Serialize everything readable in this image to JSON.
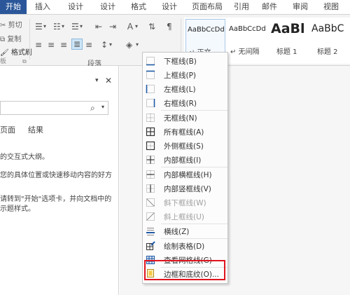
{
  "tabs": [
    "开始",
    "插入",
    "设计",
    "设计",
    "格式",
    "设计",
    "页面布局",
    "引用",
    "邮件",
    "审阅",
    "视图"
  ],
  "clipboard": {
    "cut": "剪切",
    "copy": "复制",
    "format_painter": "格式刷"
  },
  "paragraph_group_label": "段落",
  "styles": [
    {
      "sample": "AaBbCcDd",
      "name": "↵ 正文"
    },
    {
      "sample": "AaBbCcDd",
      "name": "↵ 无间隔"
    },
    {
      "sample": "AaBl",
      "name": "标题 1"
    },
    {
      "sample": "AaBbC",
      "name": "标题 2"
    }
  ],
  "nav": {
    "tabs": [
      "页面",
      "结果"
    ],
    "lines": [
      "的交互式大纲。",
      "您的具体位置或快速移动内容的好方",
      "请转到\"开始\"选项卡，并向文档中的",
      "示题样式。"
    ]
  },
  "menu": {
    "items": [
      {
        "label": "下框线(B)",
        "icon": "bottom-border-icon",
        "disabled": false
      },
      {
        "label": "上框线(P)",
        "icon": "top-border-icon",
        "disabled": false
      },
      {
        "label": "左框线(L)",
        "icon": "left-border-icon",
        "disabled": false
      },
      {
        "label": "右框线(R)",
        "icon": "right-border-icon",
        "disabled": false
      },
      {
        "label": "无框线(N)",
        "icon": "no-border-icon",
        "disabled": false
      },
      {
        "label": "所有框线(A)",
        "icon": "all-borders-icon",
        "disabled": false
      },
      {
        "label": "外侧框线(S)",
        "icon": "outside-borders-icon",
        "disabled": false
      },
      {
        "label": "内部框线(I)",
        "icon": "inside-borders-icon",
        "disabled": false
      },
      {
        "label": "内部横框线(H)",
        "icon": "inside-horizontal-border-icon",
        "disabled": false
      },
      {
        "label": "内部竖框线(V)",
        "icon": "inside-vertical-border-icon",
        "disabled": false
      },
      {
        "label": "斜下框线(W)",
        "icon": "diagonal-down-border-icon",
        "disabled": true
      },
      {
        "label": "斜上框线(U)",
        "icon": "diagonal-up-border-icon",
        "disabled": true
      },
      {
        "label": "横线(Z)",
        "icon": "horizontal-line-icon",
        "disabled": false
      },
      {
        "label": "绘制表格(D)",
        "icon": "draw-table-icon",
        "disabled": false
      },
      {
        "label": "查看网格线(G)",
        "icon": "view-gridlines-icon",
        "disabled": false
      },
      {
        "label": "边框和底纹(O)...",
        "icon": "borders-shading-icon",
        "disabled": false
      }
    ]
  },
  "colors": {
    "active_tab": "#2b579a",
    "highlight": "#e0141e",
    "icon_blue": "#1f5aa6"
  }
}
